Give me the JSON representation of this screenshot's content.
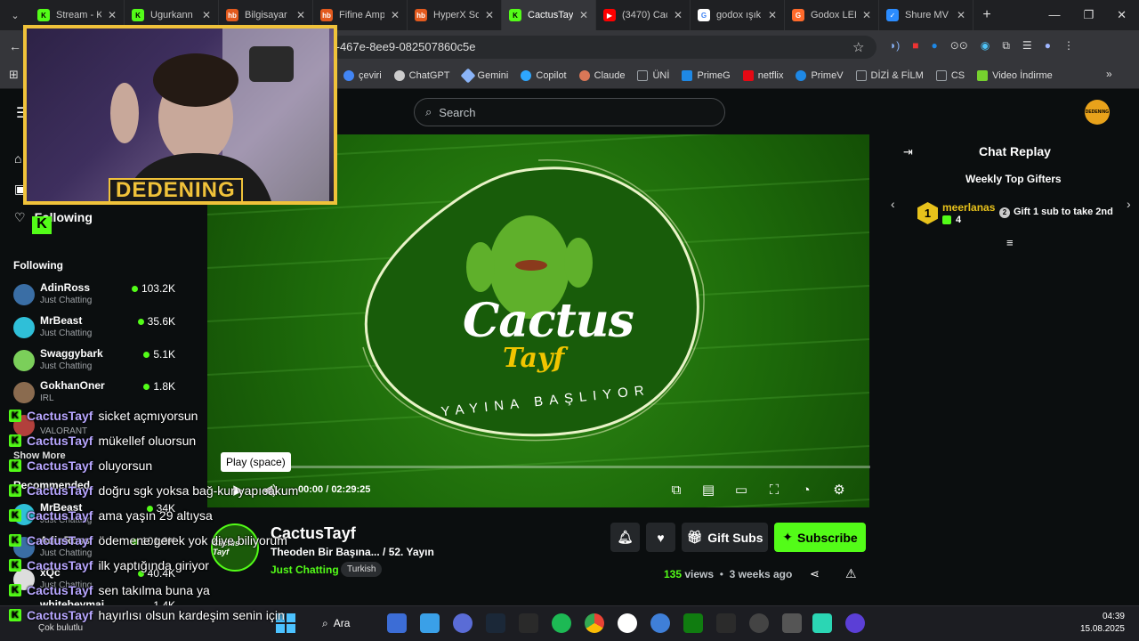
{
  "tabs": [
    {
      "title": "Stream - K",
      "color": "#53fc18",
      "glyph": "K"
    },
    {
      "title": "Ugurkann",
      "color": "#53fc18",
      "glyph": "K"
    },
    {
      "title": "Bilgisayar",
      "color": "#e35a1e",
      "glyph": "hb"
    },
    {
      "title": "Fifine Amp",
      "color": "#e35a1e",
      "glyph": "hb"
    },
    {
      "title": "HyperX So",
      "color": "#e35a1e",
      "glyph": "hb"
    },
    {
      "title": "CactusTayf",
      "color": "#53fc18",
      "glyph": "K"
    },
    {
      "title": "(3470) Cac",
      "color": "#ff0000",
      "glyph": "▶"
    },
    {
      "title": "godox ışık",
      "color": "#ffffff",
      "glyph": "G"
    },
    {
      "title": "Godox LEI",
      "color": "#ff6a2b",
      "glyph": "G"
    },
    {
      "title": "Shure MV",
      "color": "#2b8cff",
      "glyph": "✓"
    }
  ],
  "url": "f-467e-8ee9-082507860c5e",
  "bookmarks": [
    {
      "label": "çeviri",
      "color": "#4285f4"
    },
    {
      "label": "ChatGPT",
      "color": "#cccccc"
    },
    {
      "label": "Gemini",
      "color": "#8ab4f8"
    },
    {
      "label": "Copilot",
      "color": "#2ea7ff"
    },
    {
      "label": "Claude",
      "color": "#d97757"
    },
    {
      "label": "ÜNİ",
      "color": "#9aa0a6"
    },
    {
      "label": "PrimeG",
      "color": "#1e88e5"
    },
    {
      "label": "netflix",
      "color": "#e50914"
    },
    {
      "label": "PrimeV",
      "color": "#1e88e5"
    },
    {
      "label": "DİZİ & FİLM",
      "color": "#9aa0a6"
    },
    {
      "label": "CS",
      "color": "#9aa0a6"
    },
    {
      "label": "Video İndirme",
      "color": "#76d12e"
    }
  ],
  "search": {
    "placeholder": "Search"
  },
  "sidebar": {
    "following_nav": "Following",
    "following_heading": "Following",
    "show_more": "Show More",
    "recommended_heading": "Recommended",
    "channels": [
      {
        "name": "AdinRoss",
        "category": "Just Chatting",
        "viewers": "103.2K",
        "color": "#3a6ea5"
      },
      {
        "name": "MrBeast",
        "category": "Just Chatting",
        "viewers": "35.6K",
        "color": "#2fbfd8"
      },
      {
        "name": "Swaggybark",
        "category": "Just Chatting",
        "viewers": "5.1K",
        "color": "#7bcf5a"
      },
      {
        "name": "GokhanOner",
        "category": "IRL",
        "viewers": "1.8K",
        "color": "#8a6b4f"
      },
      {
        "name": "",
        "category": "VALORANT",
        "viewers": "",
        "color": "#b2403c"
      }
    ],
    "recommended": [
      {
        "name": "MrBeast",
        "category": "Just Chatting",
        "viewers": "34K",
        "color": "#2fbfd8"
      },
      {
        "name": "AdinRoss",
        "category": "Just Chatting",
        "viewers": "101.9K",
        "color": "#3a6ea5"
      },
      {
        "name": "xQc",
        "category": "Just Chatting",
        "viewers": "40.4K",
        "color": "#ddd"
      },
      {
        "name": "whitebeymai",
        "category": "Just Chatting",
        "viewers": "1.4K",
        "color": "#999"
      }
    ]
  },
  "video": {
    "logo_title": "Cactus",
    "logo_sub": "Tayf",
    "tagline": "YAYINA BAŞLIYOR",
    "tooltip": "Play (space)",
    "time_current": "00:00",
    "time_total": "02:29:25",
    "progress": 0
  },
  "stream": {
    "avatar_text": "Cactus Tayf",
    "name": "CactusTayf",
    "title": "Theoden Bir Başına... / 52. Yayın",
    "category": "Just Chatting",
    "tag": "Turkish",
    "gift_label": "Gift Subs",
    "subscribe_label": "Subscribe",
    "views_count": "135",
    "views_label": "views",
    "ago": "3 weeks ago"
  },
  "chat": {
    "title": "Chat Replay",
    "gifters_title": "Weekly Top Gifters",
    "rank": "1",
    "gifter_name": "meerlanas",
    "gifter_count": "4",
    "take_rank": "2",
    "gift_take": "Gift 1 sub to take 2nd"
  },
  "webcam": {
    "label": "DEDENING"
  },
  "overlay_chat": [
    {
      "user": "CactusTayf",
      "msg": "sicket açmıyorsun"
    },
    {
      "user": "CactusTayf",
      "msg": "mükellef oluorsun"
    },
    {
      "user": "CactusTayf",
      "msg": "oluyorsun"
    },
    {
      "user": "CactusTayf",
      "msg": "doğru sgk yoksa bağ-kur yapıcakum"
    },
    {
      "user": "CactusTayf",
      "msg": "ama yaşın 29 altıysa"
    },
    {
      "user": "CactusTayf",
      "msg": "ödemene gerek yok diye biliyorum"
    },
    {
      "user": "CactusTayf",
      "msg": "ilk yaptığında giriyor"
    },
    {
      "user": "CactusTayf",
      "msg": "sen takılma buna ya"
    },
    {
      "user": "CactusTayf",
      "msg": "hayırlısı olsun kardeşim senin için"
    }
  ],
  "taskbar": {
    "search": "Ara",
    "weather": "Çok bulutlu",
    "time": "04:39",
    "date": "15.08.2025"
  },
  "colors": {
    "accent": "#53fc18",
    "cam_border": "#f0c23a"
  }
}
